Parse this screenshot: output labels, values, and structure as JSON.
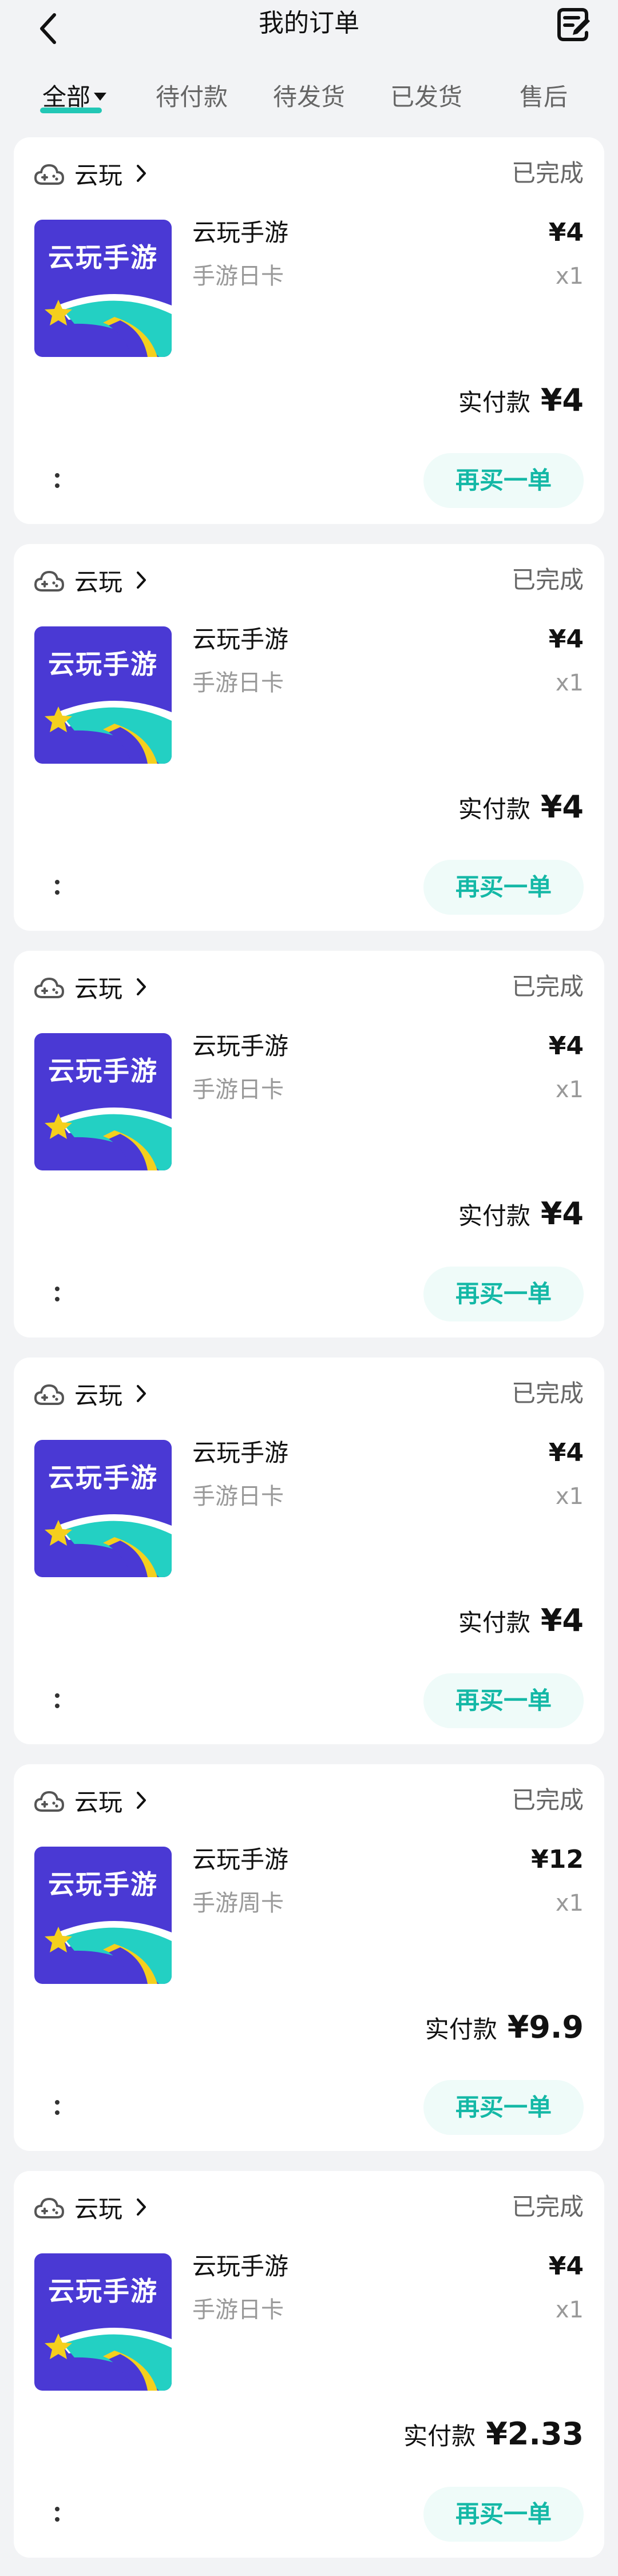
{
  "header": {
    "title": "我的订单"
  },
  "tabs": [
    {
      "label": "全部",
      "active": true
    },
    {
      "label": "待付款",
      "active": false
    },
    {
      "label": "待发货",
      "active": false
    },
    {
      "label": "已发货",
      "active": false
    },
    {
      "label": "售后",
      "active": false
    }
  ],
  "colors": {
    "accent": "#22c7b5",
    "rebuy_text": "#14b8a6",
    "rebuy_bg": "#effbf9",
    "thumb_bg": "#4a39d4"
  },
  "orders": [
    {
      "shop": "云玩",
      "status": "已完成",
      "thumb_text": "云玩手游",
      "product": "云玩手游",
      "spec": "手游日卡",
      "price": "¥4",
      "qty": "x1",
      "paid_label": "实付款",
      "paid": "¥4",
      "rebuy": "再买一单"
    },
    {
      "shop": "云玩",
      "status": "已完成",
      "thumb_text": "云玩手游",
      "product": "云玩手游",
      "spec": "手游日卡",
      "price": "¥4",
      "qty": "x1",
      "paid_label": "实付款",
      "paid": "¥4",
      "rebuy": "再买一单"
    },
    {
      "shop": "云玩",
      "status": "已完成",
      "thumb_text": "云玩手游",
      "product": "云玩手游",
      "spec": "手游日卡",
      "price": "¥4",
      "qty": "x1",
      "paid_label": "实付款",
      "paid": "¥4",
      "rebuy": "再买一单"
    },
    {
      "shop": "云玩",
      "status": "已完成",
      "thumb_text": "云玩手游",
      "product": "云玩手游",
      "spec": "手游日卡",
      "price": "¥4",
      "qty": "x1",
      "paid_label": "实付款",
      "paid": "¥4",
      "rebuy": "再买一单"
    },
    {
      "shop": "云玩",
      "status": "已完成",
      "thumb_text": "云玩手游",
      "product": "云玩手游",
      "spec": "手游周卡",
      "price": "¥12",
      "qty": "x1",
      "paid_label": "实付款",
      "paid": "¥9.9",
      "rebuy": "再买一单"
    },
    {
      "shop": "云玩",
      "status": "已完成",
      "thumb_text": "云玩手游",
      "product": "云玩手游",
      "spec": "手游日卡",
      "price": "¥4",
      "qty": "x1",
      "paid_label": "实付款",
      "paid": "¥2.33",
      "rebuy": "再买一单"
    }
  ]
}
